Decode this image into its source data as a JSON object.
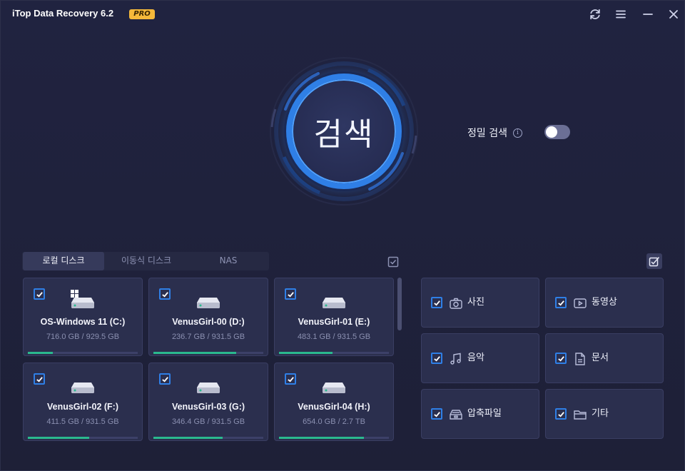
{
  "app": {
    "title": "iTop Data Recovery 6.2",
    "badge": "PRO"
  },
  "titlebar_icons": [
    "refresh-icon",
    "menu-icon",
    "minimize-icon",
    "close-icon"
  ],
  "scan": {
    "label": "검색"
  },
  "deep_scan": {
    "label": "정밀 검색",
    "info": "i",
    "enabled": false
  },
  "tabs": [
    {
      "label": "로컬 디스크",
      "active": true
    },
    {
      "label": "이동식 디스크",
      "active": false
    },
    {
      "label": "NAS",
      "active": false
    }
  ],
  "disks": [
    {
      "name": "OS-Windows 11 (C:)",
      "size": "716.0 GB / 929.5 GB",
      "usage": 0.23,
      "checked": true,
      "system": true
    },
    {
      "name": "VenusGirl-00 (D:)",
      "size": "236.7 GB / 931.5 GB",
      "usage": 0.75,
      "checked": true,
      "system": false
    },
    {
      "name": "VenusGirl-01 (E:)",
      "size": "483.1 GB / 931.5 GB",
      "usage": 0.49,
      "checked": true,
      "system": false
    },
    {
      "name": "VenusGirl-02 (F:)",
      "size": "411.5 GB / 931.5 GB",
      "usage": 0.56,
      "checked": true,
      "system": false
    },
    {
      "name": "VenusGirl-03 (G:)",
      "size": "346.4 GB / 931.5 GB",
      "usage": 0.63,
      "checked": true,
      "system": false
    },
    {
      "name": "VenusGirl-04 (H:)",
      "size": "654.0 GB / 2.7 TB",
      "usage": 0.77,
      "checked": true,
      "system": false
    }
  ],
  "file_types": [
    {
      "label": "사진",
      "icon": "camera-icon",
      "checked": true
    },
    {
      "label": "동영상",
      "icon": "video-icon",
      "checked": true
    },
    {
      "label": "음악",
      "icon": "music-icon",
      "checked": true
    },
    {
      "label": "문서",
      "icon": "document-icon",
      "checked": true
    },
    {
      "label": "압축파일",
      "icon": "archive-icon",
      "checked": true
    },
    {
      "label": "기타",
      "icon": "folder-icon",
      "checked": true
    }
  ],
  "colors": {
    "accent": "#2f7fe6",
    "usage_bar": "#2ab98e",
    "badge": "#f5b93a",
    "background": "#1f2138",
    "card": "#2b2f4e"
  }
}
